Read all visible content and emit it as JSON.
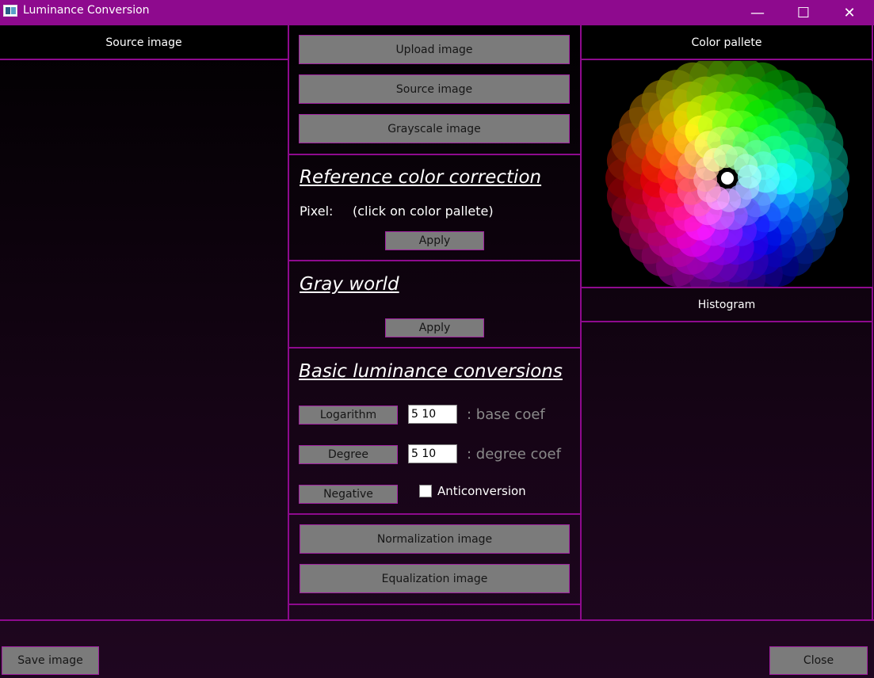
{
  "window": {
    "title": "Luminance Conversion",
    "minimize": "—",
    "maximize": "☐",
    "close": "✕"
  },
  "left_panel": {
    "header": "Source image"
  },
  "center_panel": {
    "upload_button": "Upload image",
    "source_button": "Source image",
    "grayscale_button": "Grayscale image",
    "reference": {
      "title": "Reference color correction",
      "pixel_label": "Pixel:",
      "pixel_hint": "(click on color pallete)",
      "apply": "Apply"
    },
    "gray_world": {
      "title": "Gray world",
      "apply": "Apply"
    },
    "basic": {
      "title": "Basic luminance conversions",
      "logarithm_button": "Logarithm",
      "logarithm_value": "5 10",
      "logarithm_hint": ": base coef",
      "degree_button": "Degree",
      "degree_value": "5 10",
      "degree_hint": ": degree coef",
      "negative_button": "Negative",
      "anticonversion_label": "Anticonversion",
      "anticonversion_checked": false
    },
    "normalization_button": "Normalization image",
    "equalization_button": "Equalization image"
  },
  "right_panel": {
    "palette_header": "Color pallete",
    "histogram_header": "Histogram"
  },
  "footer": {
    "save_button": "Save image",
    "close_button": "Close"
  },
  "colors": {
    "accent": "#8e0a8e",
    "button": "#7b7b7b",
    "hint_text": "#8a8a8a"
  }
}
